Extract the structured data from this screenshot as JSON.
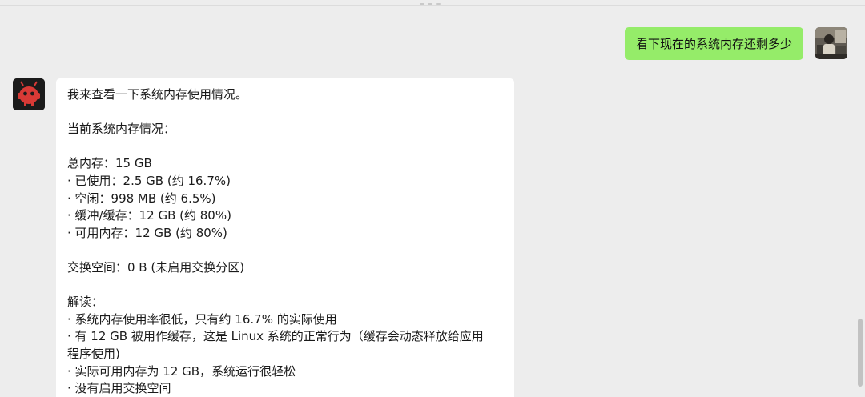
{
  "conversation": {
    "user_message": "看下现在的系统内存还剩多少",
    "bot_lines": [
      "我来查看一下系统内存使用情况。",
      "",
      "当前系统内存情况：",
      "",
      "总内存：15 GB",
      "· 已使用：2.5 GB (约 16.7%)",
      "· 空闲：998 MB (约 6.5%)",
      "· 缓冲/缓存：12 GB (约 80%)",
      "· 可用内存：12 GB (约 80%)",
      "",
      "交换空间：0 B (未启用交换分区)",
      "",
      "解读：",
      "· 系统内存使用率很低，只有约 16.7% 的实际使用",
      "· 有 12 GB 被用作缓存，这是 Linux 系统的正常行为（缓存会动态释放给应用",
      "程序使用)",
      "· 实际可用内存为 12 GB，系统运行很轻松",
      "· 没有启用交换空间"
    ]
  },
  "colors": {
    "background": "#ededed",
    "outgoing_bubble": "#95ec69",
    "incoming_bubble": "#ffffff",
    "bot_avatar_accent": "#d83a36"
  },
  "icons": {
    "user_avatar": "user-photo-avatar",
    "bot_avatar": "red-robot-avatar"
  }
}
